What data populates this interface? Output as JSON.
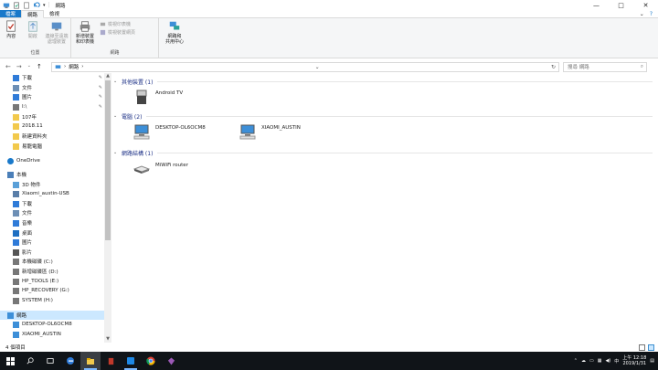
{
  "window": {
    "title": "網路",
    "controls": {
      "minimize": "—",
      "maximize": "□",
      "close": "✕"
    }
  },
  "ribbon_tabs": [
    {
      "label": "檔案",
      "kind": "file"
    },
    {
      "label": "網路",
      "kind": "active"
    },
    {
      "label": "檢視",
      "kind": "normal"
    }
  ],
  "ribbon_right": {
    "expand": "⌄",
    "help": "?"
  },
  "ribbon": {
    "location_group": {
      "label": "位置",
      "buttons": [
        {
          "label": "內容",
          "icon": "properties-check-icon",
          "disabled": false
        },
        {
          "label": "開啟",
          "icon": "open-icon",
          "disabled": true
        },
        {
          "label": "連線至遠端\n處理裝置",
          "icon": "connect-remote-icon",
          "disabled": true
        }
      ]
    },
    "network_group": {
      "label": "網路",
      "big": {
        "label": "新增裝置\n和印表機",
        "icon": "printer-icon"
      },
      "smalls": [
        {
          "label": "檢視印表機",
          "icon": "view-printers-icon"
        },
        {
          "label": "檢視裝置網頁",
          "icon": "device-webpage-icon"
        }
      ]
    },
    "share_group": {
      "label": "",
      "big": {
        "label": "網路和\n共用中心",
        "icon": "network-center-icon"
      }
    }
  },
  "nav": {
    "back": "←",
    "forward": "→",
    "recent": "⌄",
    "up": "↑"
  },
  "address": {
    "path_root": "›",
    "path": "網路",
    "arrow": "›",
    "dropdown": "⌄",
    "refresh": "↻"
  },
  "search": {
    "placeholder": "搜尋 網路"
  },
  "sidebar": {
    "items": [
      {
        "label": "下載",
        "icon": "download-icon",
        "pinned": true
      },
      {
        "label": "文件",
        "icon": "documents-icon",
        "pinned": true
      },
      {
        "label": "圖片",
        "icon": "pictures-icon",
        "pinned": true
      },
      {
        "label": "I:\\",
        "icon": "drive-icon",
        "pinned": true
      },
      {
        "label": "107年",
        "icon": "folder-icon",
        "pinned": false
      },
      {
        "label": "2018.11",
        "icon": "folder-icon",
        "pinned": false
      },
      {
        "label": "新建資料夾",
        "icon": "folder-icon",
        "pinned": false
      },
      {
        "label": "易龍電腦",
        "icon": "folder-icon",
        "pinned": false
      },
      {
        "label": "OneDrive",
        "icon": "onedrive-icon",
        "pinned": false
      },
      {
        "label": "本機",
        "icon": "this-pc-icon",
        "pinned": false
      },
      {
        "label": "3D 物件",
        "icon": "3d-objects-icon",
        "pinned": false
      },
      {
        "label": "Xiaomi_austin-USB",
        "icon": "usb-device-icon",
        "pinned": false
      },
      {
        "label": "下載",
        "icon": "download-icon",
        "pinned": false
      },
      {
        "label": "文件",
        "icon": "documents-icon",
        "pinned": false
      },
      {
        "label": "音樂",
        "icon": "music-icon",
        "pinned": false
      },
      {
        "label": "桌面",
        "icon": "desktop-icon",
        "pinned": false
      },
      {
        "label": "圖片",
        "icon": "pictures-icon",
        "pinned": false
      },
      {
        "label": "影片",
        "icon": "videos-icon",
        "pinned": false
      },
      {
        "label": "本機磁碟 (C:)",
        "icon": "drive-icon",
        "pinned": false
      },
      {
        "label": "新增磁碟區 (D:)",
        "icon": "drive-icon",
        "pinned": false
      },
      {
        "label": "HP_TOOLS (E:)",
        "icon": "drive-icon",
        "pinned": false
      },
      {
        "label": "HP_RECOVERY (G:)",
        "icon": "drive-icon",
        "pinned": false
      },
      {
        "label": "SYSTEM (H:)",
        "icon": "drive-icon",
        "pinned": false
      },
      {
        "label": "網路",
        "icon": "network-icon",
        "pinned": false,
        "selected": true
      },
      {
        "label": "DESKTOP-OL6OCM8",
        "icon": "computer-icon",
        "pinned": false
      },
      {
        "label": "XIAOMI_AUSTIN",
        "icon": "computer-icon",
        "pinned": false
      }
    ]
  },
  "groups": [
    {
      "label": "其他裝置 (1)",
      "devices": [
        {
          "label": "Android TV",
          "icon": "media-device-icon"
        }
      ]
    },
    {
      "label": "電腦 (2)",
      "devices": [
        {
          "label": "DESKTOP-OL6OCM8",
          "icon": "computer-icon"
        },
        {
          "label": "XIAOMI_AUSTIN",
          "icon": "computer-icon"
        }
      ]
    },
    {
      "label": "網路結構 (1)",
      "devices": [
        {
          "label": "MiWiFi router",
          "icon": "router-icon"
        }
      ]
    }
  ],
  "status": {
    "count": "4 個項目"
  },
  "taskbar": {
    "apps": [
      "windows-start-icon",
      "search-icon",
      "task-view-icon",
      "edge-icon",
      "file-explorer-icon",
      "red-app-icon",
      "blue-app-icon",
      "chrome-icon",
      "kite-icon"
    ],
    "time": "上午 12:18",
    "date": "2019/1/31"
  },
  "colors": {
    "accent": "#1979ca",
    "selection": "#cce8ff",
    "group_heading": "#1e3287",
    "taskbar": "#101418"
  }
}
